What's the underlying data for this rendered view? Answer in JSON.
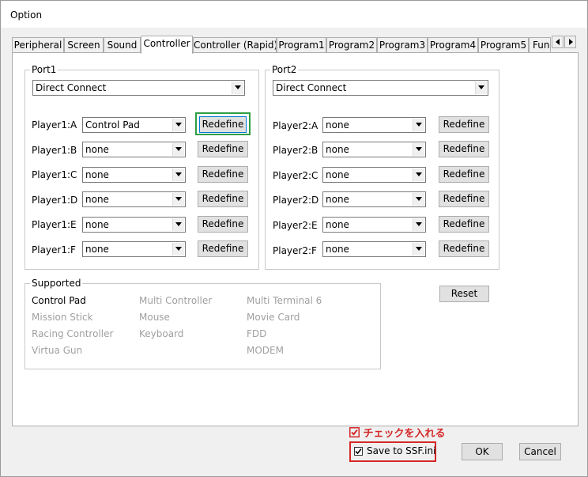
{
  "window": {
    "title": "Option"
  },
  "tabs": [
    {
      "label": "Peripheral"
    },
    {
      "label": "Screen"
    },
    {
      "label": "Sound"
    },
    {
      "label": "Controller",
      "active": true
    },
    {
      "label": "Controller (Rapid)"
    },
    {
      "label": "Program1"
    },
    {
      "label": "Program2"
    },
    {
      "label": "Program3"
    },
    {
      "label": "Program4"
    },
    {
      "label": "Program5"
    },
    {
      "label": "Fun"
    }
  ],
  "tab_scroll": {
    "left_icon": "triangle-left-icon",
    "right_icon": "triangle-right-icon"
  },
  "port1": {
    "label": "Port1",
    "connection": "Direct Connect",
    "players": [
      {
        "label": "Player1:A",
        "value": "Control Pad",
        "button": "Redefine"
      },
      {
        "label": "Player1:B",
        "value": "none",
        "button": "Redefine"
      },
      {
        "label": "Player1:C",
        "value": "none",
        "button": "Redefine"
      },
      {
        "label": "Player1:D",
        "value": "none",
        "button": "Redefine"
      },
      {
        "label": "Player1:E",
        "value": "none",
        "button": "Redefine"
      },
      {
        "label": "Player1:F",
        "value": "none",
        "button": "Redefine"
      }
    ]
  },
  "port2": {
    "label": "Port2",
    "connection": "Direct Connect",
    "players": [
      {
        "label": "Player2:A",
        "value": "none",
        "button": "Redefine"
      },
      {
        "label": "Player2:B",
        "value": "none",
        "button": "Redefine"
      },
      {
        "label": "Player2:C",
        "value": "none",
        "button": "Redefine"
      },
      {
        "label": "Player2:D",
        "value": "none",
        "button": "Redefine"
      },
      {
        "label": "Player2:E",
        "value": "none",
        "button": "Redefine"
      },
      {
        "label": "Player2:F",
        "value": "none",
        "button": "Redefine"
      }
    ]
  },
  "supported": {
    "label": "Supported",
    "items": [
      {
        "label": "Control Pad",
        "enabled": true
      },
      {
        "label": "Multi Controller",
        "enabled": false
      },
      {
        "label": "Multi Terminal 6",
        "enabled": false
      },
      {
        "label": "Mission Stick",
        "enabled": false
      },
      {
        "label": "Mouse",
        "enabled": false
      },
      {
        "label": "Movie Card",
        "enabled": false
      },
      {
        "label": "Racing Controller",
        "enabled": false
      },
      {
        "label": "Keyboard",
        "enabled": false
      },
      {
        "label": "FDD",
        "enabled": false
      },
      {
        "label": "Virtua Gun",
        "enabled": false
      },
      {
        "label": "MODEM",
        "enabled": false
      }
    ]
  },
  "reset_button": "Reset",
  "annotation": {
    "text": "チェックを入れる",
    "icon": "checked-box-icon",
    "color": "#d42828",
    "highlight_color": "#2f9e44"
  },
  "save_checkbox": {
    "label": "Save to SSF.ini",
    "checked": true
  },
  "ok_button": "OK",
  "cancel_button": "Cancel"
}
